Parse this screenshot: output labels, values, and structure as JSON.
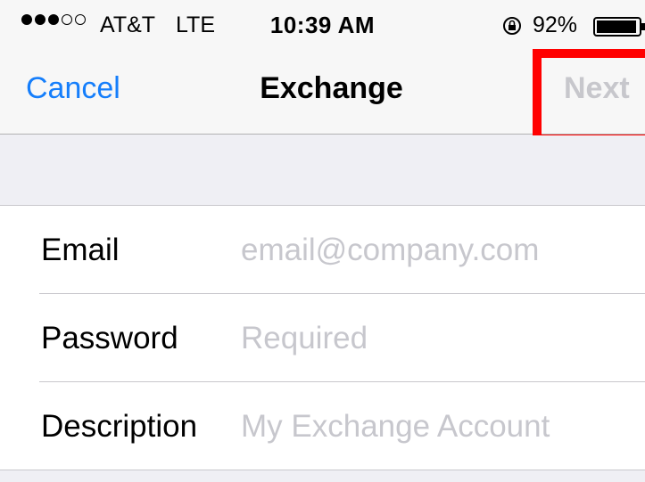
{
  "status_bar": {
    "signal_filled": 3,
    "signal_empty": 2,
    "carrier": "AT&T",
    "network": "LTE",
    "time": "10:39 AM",
    "battery_percent": "92%",
    "icons": [
      "orientation-lock-icon",
      "battery-icon"
    ]
  },
  "nav": {
    "cancel_label": "Cancel",
    "title": "Exchange",
    "next_label": "Next"
  },
  "form": {
    "fields": [
      {
        "label": "Email",
        "placeholder": "email@company.com",
        "value": ""
      },
      {
        "label": "Password",
        "placeholder": "Required",
        "value": ""
      },
      {
        "label": "Description",
        "placeholder": "My Exchange Account",
        "value": ""
      }
    ]
  },
  "colors": {
    "accent": "#157efb",
    "disabled": "#c7c7cc",
    "highlight": "#ff0000",
    "background": "#efeff4",
    "header": "#f7f7f7"
  }
}
